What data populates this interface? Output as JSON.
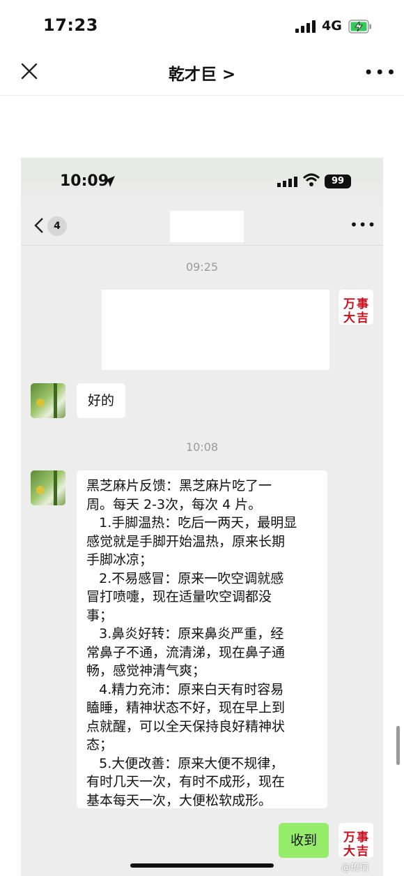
{
  "status": {
    "time": "17:23",
    "network": "4G"
  },
  "nav": {
    "title": "乾才巨 >"
  },
  "inner": {
    "time": "10:09",
    "battery": "99",
    "unread_count": "4"
  },
  "chat": {
    "timestamp1": "09:25",
    "timestamp2": "10:08",
    "sender_avatar_text": [
      "万",
      "事",
      "大",
      "吉"
    ],
    "msg_ok": "好的",
    "feedback": [
      "黑芝麻片反馈：黑芝麻片吃了一",
      "周。每天 2-3次，每次 4 片。",
      "   1.手脚温热：吃后一两天，最明显",
      "感觉就是手脚开始温热，原来长期",
      "手脚冰凉；",
      "   2.不易感冒：原来一吹空调就感",
      "冒打喷嚏，现在适量吹空调都没",
      "事；",
      "   3.鼻炎好转：原来鼻炎严重，经",
      "常鼻子不通，流清涕，现在鼻子通",
      "畅，感觉神清气爽；",
      "   4.精力充沛：原来白天有时容易",
      "瞌睡，精神状态不好，现在早上到",
      "点就醒，可以全天保持良好精神状",
      "态；",
      "   5.大便改善：原来大便不规律，",
      "有时几天一次，有时不成形，现在",
      "基本每天一次，大便松软成形。"
    ],
    "reply": "收到"
  },
  "watermark": "@琉璃"
}
